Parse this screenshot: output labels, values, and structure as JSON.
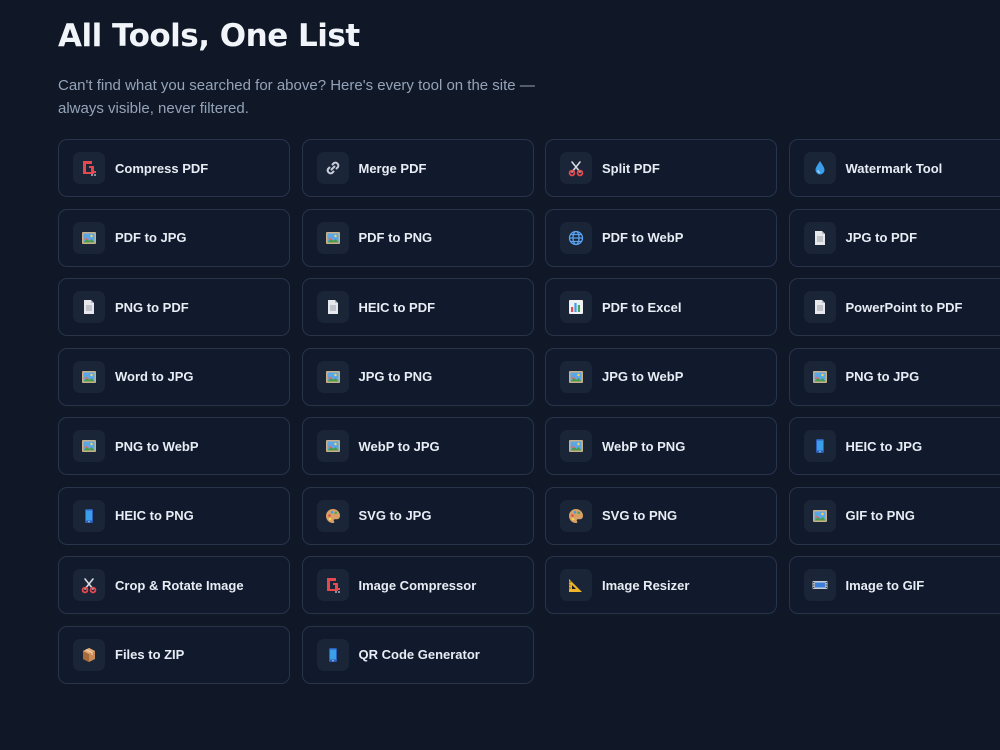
{
  "header": {
    "title": "All Tools, One List",
    "subtitle": "Can't find what you searched for above? Here's every tool on the site — always visible, never filtered."
  },
  "tools": [
    {
      "label": "Compress PDF",
      "icon": "compress-icon"
    },
    {
      "label": "Merge PDF",
      "icon": "link-icon"
    },
    {
      "label": "Split PDF",
      "icon": "scissors-icon"
    },
    {
      "label": "Watermark Tool",
      "icon": "droplet-icon"
    },
    {
      "label": "PDF to JPG",
      "icon": "picture-icon"
    },
    {
      "label": "PDF to PNG",
      "icon": "picture-icon"
    },
    {
      "label": "PDF to WebP",
      "icon": "globe-icon"
    },
    {
      "label": "JPG to PDF",
      "icon": "document-icon"
    },
    {
      "label": "PNG to PDF",
      "icon": "document-icon"
    },
    {
      "label": "HEIC to PDF",
      "icon": "document-icon"
    },
    {
      "label": "PDF to Excel",
      "icon": "bar-chart-icon"
    },
    {
      "label": "PowerPoint to PDF",
      "icon": "document-icon"
    },
    {
      "label": "Word to JPG",
      "icon": "picture-icon"
    },
    {
      "label": "JPG to PNG",
      "icon": "picture-icon"
    },
    {
      "label": "JPG to WebP",
      "icon": "picture-icon"
    },
    {
      "label": "PNG to JPG",
      "icon": "picture-icon"
    },
    {
      "label": "PNG to WebP",
      "icon": "picture-icon"
    },
    {
      "label": "WebP to JPG",
      "icon": "picture-icon"
    },
    {
      "label": "WebP to PNG",
      "icon": "picture-icon"
    },
    {
      "label": "HEIC to JPG",
      "icon": "phone-icon"
    },
    {
      "label": "HEIC to PNG",
      "icon": "phone-icon"
    },
    {
      "label": "SVG to JPG",
      "icon": "palette-icon"
    },
    {
      "label": "SVG to PNG",
      "icon": "palette-icon"
    },
    {
      "label": "GIF to PNG",
      "icon": "picture-icon"
    },
    {
      "label": "Crop & Rotate Image",
      "icon": "scissors-icon"
    },
    {
      "label": "Image Compressor",
      "icon": "compress-icon"
    },
    {
      "label": "Image Resizer",
      "icon": "ruler-icon"
    },
    {
      "label": "Image to GIF",
      "icon": "film-icon"
    },
    {
      "label": "Files to ZIP",
      "icon": "package-icon"
    },
    {
      "label": "QR Code Generator",
      "icon": "phone-icon"
    }
  ],
  "colors": {
    "background": "#101828",
    "card_background": "#111a2c",
    "card_border": "#273449",
    "icon_background": "#1b2538",
    "title": "#f1f5f9",
    "subtitle": "#94a3b8",
    "label": "#e8edf5"
  }
}
